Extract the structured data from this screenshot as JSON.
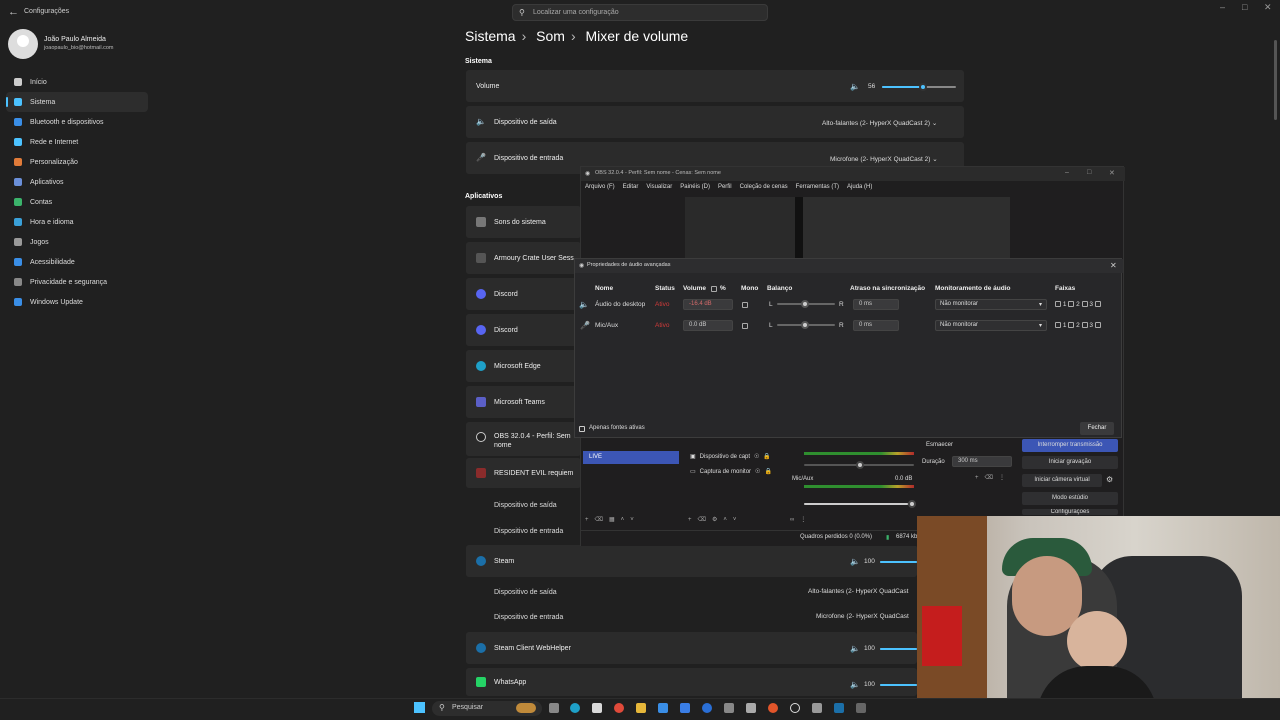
{
  "settings": {
    "app_title": "Configurações",
    "search_placeholder": "Localizar uma configuração",
    "user_name": "João Paulo Almeida",
    "user_email": "joaopaulo_bio@hotmail.com",
    "breadcrumb": [
      "Sistema",
      "Som",
      "Mixer de volume"
    ],
    "nav": [
      {
        "label": "Início",
        "color": "#cccccc"
      },
      {
        "label": "Sistema",
        "color": "#4cc2ff"
      },
      {
        "label": "Bluetooth e dispositivos",
        "color": "#3a8ee6"
      },
      {
        "label": "Rede e Internet",
        "color": "#4cc2ff"
      },
      {
        "label": "Personalização",
        "color": "#e07b39"
      },
      {
        "label": "Aplicativos",
        "color": "#6a8fd8"
      },
      {
        "label": "Contas",
        "color": "#3bb36b"
      },
      {
        "label": "Hora e idioma",
        "color": "#3aa0d8"
      },
      {
        "label": "Jogos",
        "color": "#999999"
      },
      {
        "label": "Acessibilidade",
        "color": "#3a8ee6"
      },
      {
        "label": "Privacidade e segurança",
        "color": "#888888"
      },
      {
        "label": "Windows Update",
        "color": "#3a8ee6"
      }
    ],
    "system_section": "Sistema",
    "volume_label": "Volume",
    "volume_value": "56",
    "output_device_label": "Dispositivo de saída",
    "output_device_value": "Alto-falantes (2- HyperX QuadCast 2)",
    "input_device_label": "Dispositivo de entrada",
    "input_device_value": "Microfone (2- HyperX QuadCast 2)",
    "apps_section": "Aplicativos",
    "apps": [
      "Sons do sistema",
      "Armoury Crate User Sess",
      "Discord",
      "Discord",
      "Microsoft Edge",
      "Microsoft Teams",
      "OBS 32.0.4 - Perfil: Sem nome",
      "RESIDENT EVIL requiem"
    ],
    "steam_label": "Steam",
    "steam_volume": "100",
    "steam_output_value": "Alto-falantes (2- HyperX QuadCast",
    "steam_input_value": "Microfone (2- HyperX QuadCast",
    "steam_helper_label": "Steam Client WebHelper",
    "steam_helper_volume": "100",
    "whatsapp_label": "WhatsApp",
    "whatsapp_volume": "100"
  },
  "obs": {
    "title": "OBS 32.0.4 - Perfil: Sem nome - Cenas: Sem nome",
    "menu": [
      "Arquivo (F)",
      "Editar",
      "Visualizar",
      "Painéis (D)",
      "Perfil",
      "Coleção de cenas",
      "Ferramentas (T)",
      "Ajuda (H)"
    ],
    "scene_live": "LIVE",
    "sources": [
      "Dispositivo de capt",
      "Captura de monitor"
    ],
    "mixer_mic": "Mic/Aux",
    "mixer_mic_db": "0.0 dB",
    "transition": "Esmaecer",
    "duration_label": "Duração",
    "duration_value": "300 ms",
    "controls": [
      "Interromper transmissão",
      "Iniciar gravação",
      "Iniciar câmera virtual",
      "Modo estúdio",
      "Configurações"
    ],
    "status": "Quadros perdidos 0 (0.0%)",
    "bitrate": "6874 kb"
  },
  "advanced": {
    "title": "Propriedades de áudio avançadas",
    "headers": {
      "name": "Nome",
      "status": "Status",
      "volume": "Volume",
      "percent": "%",
      "mono": "Mono",
      "balance": "Balanço",
      "sync": "Atraso na sincronização",
      "monitor": "Monitoramento de áudio",
      "tracks": "Faixas"
    },
    "rows": [
      {
        "name": "Áudio do desktop",
        "status": "Ativo",
        "volume": "-16.4 dB",
        "sync": "0 ms",
        "monitor": "Não monitorar"
      },
      {
        "name": "Mic/Aux",
        "status": "Ativo",
        "volume": "0.0 dB",
        "sync": "0 ms",
        "monitor": "Não monitorar"
      }
    ],
    "balance_left": "L",
    "balance_right": "R",
    "track_labels": [
      "1",
      "2",
      "3",
      "4"
    ],
    "active_only": "Apenas fontes ativas",
    "close_button": "Fechar"
  },
  "taskbar": {
    "search": "Pesquisar"
  }
}
